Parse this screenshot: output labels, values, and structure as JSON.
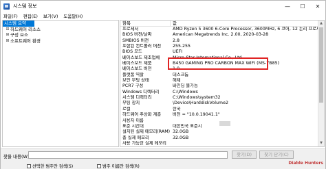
{
  "window": {
    "title": "시스템 정보"
  },
  "window_controls": {
    "minimize": "—",
    "maximize": "☐",
    "close": "✕"
  },
  "menu": [
    "파일(F)",
    "편집(E)",
    "보기(V)",
    "도움말(H)"
  ],
  "tree": [
    {
      "label": "시스템 요약",
      "selected": true,
      "expander": ""
    },
    {
      "label": "하드웨어 리소스",
      "expander": "⊞"
    },
    {
      "label": "구성 요소",
      "expander": "⊞"
    },
    {
      "label": "소프트웨어 환경",
      "expander": "⊞"
    }
  ],
  "list": {
    "headers": {
      "item": "항목",
      "value": "값"
    },
    "rows": [
      {
        "item": "프로세서",
        "value": "AMD Ryzen 5 3600 6-Core Processor, 3600MHz, 6 코어, 12 논리 프로세서"
      },
      {
        "item": "BIOS 버전/날짜",
        "value": "American Megatrends Inc. 2.00, 2020-03-28"
      },
      {
        "item": "SMBIOS 버전",
        "value": "2.8"
      },
      {
        "item": "포함된 컨트롤러 버전",
        "value": "255.255"
      },
      {
        "item": "BIOS 모드",
        "value": "UEFI"
      },
      {
        "item": "베이스보드 제조업체",
        "value": "Micro-Star International Co., Ltd."
      },
      {
        "item": "베이스보드 제품",
        "value": "B450 GAMING PRO CARBON MAX WIFI (MS-7B85)"
      },
      {
        "item": "베이스보드 버전",
        "value": "1.0"
      },
      {
        "item": "플랫폼 역할",
        "value": "데스크톱"
      },
      {
        "item": "보안 부팅 상태",
        "value": "해제"
      },
      {
        "item": "PCR7 구성",
        "value": "바인딩 불가능"
      },
      {
        "item": "Windows 디렉터리",
        "value": "C:\\Windows"
      },
      {
        "item": "시스템 디렉터리",
        "value": "C:\\Windows\\system32"
      },
      {
        "item": "부팅 장치",
        "value": "\\Device\\HarddiskVolume2"
      },
      {
        "item": "로캘",
        "value": "한국"
      },
      {
        "item": "하드웨어 추상화 계층",
        "value": "버전 = \"10.0.19041.1\""
      },
      {
        "item": "사용자 이름",
        "value": ""
      },
      {
        "item": "표준 시간대",
        "value": "대한민국 표준시"
      },
      {
        "item": "설치된 실제 메모리(RAM)",
        "value": "32.0GB"
      },
      {
        "item": "총 실제 메모리",
        "value": "32.0GB"
      },
      {
        "item": "사용 가능한 실제 메모리",
        "value": ""
      }
    ]
  },
  "findbar": {
    "label": "찾을 내용(W):",
    "input_value": "",
    "find_button": "찾기(D)",
    "close_button": "찾기 닫기(C)",
    "checkbox_selected": "선택한 범주만 검색(S)",
    "checkbox_names": "범주 이름만 검색(R)"
  },
  "watermark": "Diable Hunters"
}
